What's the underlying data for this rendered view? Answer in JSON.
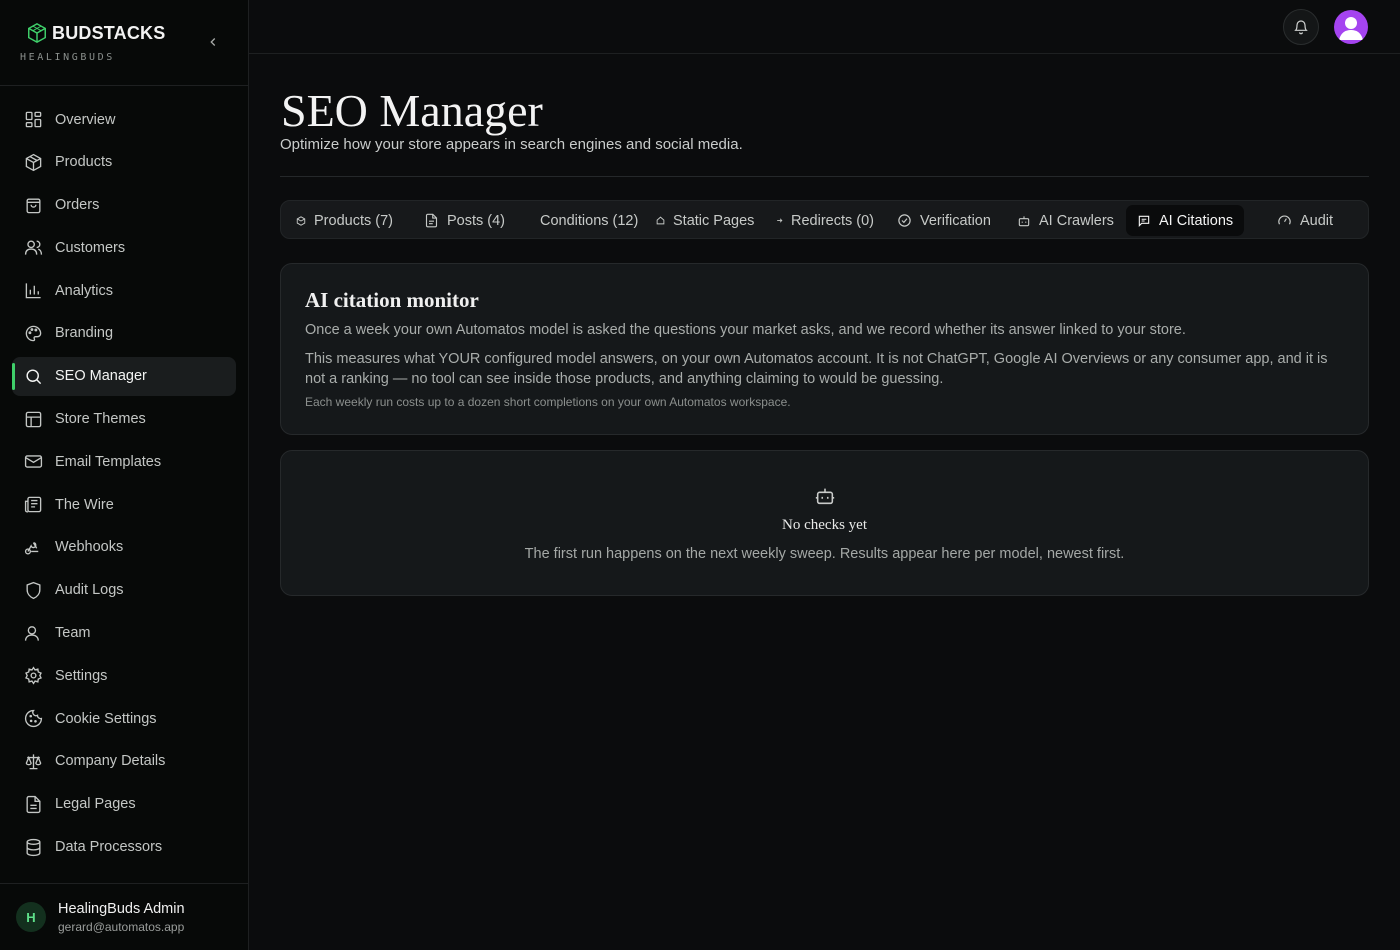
{
  "brand": {
    "name": "BUDSTACKS",
    "sub": "HEALINGBUDS",
    "accent": "#3fcf6a"
  },
  "sidebar": {
    "items": [
      {
        "label": "Overview",
        "icon": "grid-icon"
      },
      {
        "label": "Products",
        "icon": "package-icon"
      },
      {
        "label": "Orders",
        "icon": "shopping-bag-icon"
      },
      {
        "label": "Customers",
        "icon": "users-icon"
      },
      {
        "label": "Analytics",
        "icon": "bar-chart-icon"
      },
      {
        "label": "Branding",
        "icon": "palette-icon"
      },
      {
        "label": "SEO Manager",
        "icon": "search-icon"
      },
      {
        "label": "Store Themes",
        "icon": "layout-icon"
      },
      {
        "label": "Email Templates",
        "icon": "mail-icon"
      },
      {
        "label": "The Wire",
        "icon": "newspaper-icon"
      },
      {
        "label": "Webhooks",
        "icon": "webhook-icon"
      },
      {
        "label": "Audit Logs",
        "icon": "shield-icon"
      },
      {
        "label": "Team",
        "icon": "user-icon"
      },
      {
        "label": "Settings",
        "icon": "gear-icon"
      },
      {
        "label": "Cookie Settings",
        "icon": "cookie-icon"
      },
      {
        "label": "Company Details",
        "icon": "scale-icon"
      },
      {
        "label": "Legal Pages",
        "icon": "file-text-icon"
      },
      {
        "label": "Data Processors",
        "icon": "database-icon"
      }
    ],
    "active": "SEO Manager"
  },
  "user": {
    "initial": "H",
    "name": "HealingBuds Admin",
    "email": "gerard@automatos.app"
  },
  "header": {
    "title": "SEO Manager",
    "subtitle": "Optimize how your store appears in search engines and social media."
  },
  "tabs": [
    {
      "label": "Products (7)",
      "icon": "package-icon"
    },
    {
      "label": "Posts (4)",
      "icon": "file-icon"
    },
    {
      "label": "Conditions (12)",
      "icon": ""
    },
    {
      "label": "Static Pages",
      "icon": "home-icon"
    },
    {
      "label": "Redirects (0)",
      "icon": "arrow-icon"
    },
    {
      "label": "Verification",
      "icon": "check-circle-icon"
    },
    {
      "label": "AI Crawlers",
      "icon": "bot-icon"
    },
    {
      "label": "AI Citations",
      "icon": "message-square-icon"
    },
    {
      "label": "Audit",
      "icon": "gauge-icon"
    }
  ],
  "activeTab": "AI Citations",
  "monitor": {
    "title": "AI citation monitor",
    "p1": "Once a week your own Automatos model is asked the questions your market asks, and we record whether its answer linked to your store.",
    "p2": "This measures what YOUR configured model answers, on your own Automatos account. It is not ChatGPT, Google AI Overviews or any consumer app, and it is not a ranking — no tool can see inside those products, and anything claiming to would be guessing.",
    "note": "Each weekly run costs up to a dozen short completions on your own Automatos workspace."
  },
  "empty": {
    "icon": "bot-icon",
    "title": "No checks yet",
    "text": "The first run happens on the next weekly sweep. Results appear here per model, newest first."
  }
}
